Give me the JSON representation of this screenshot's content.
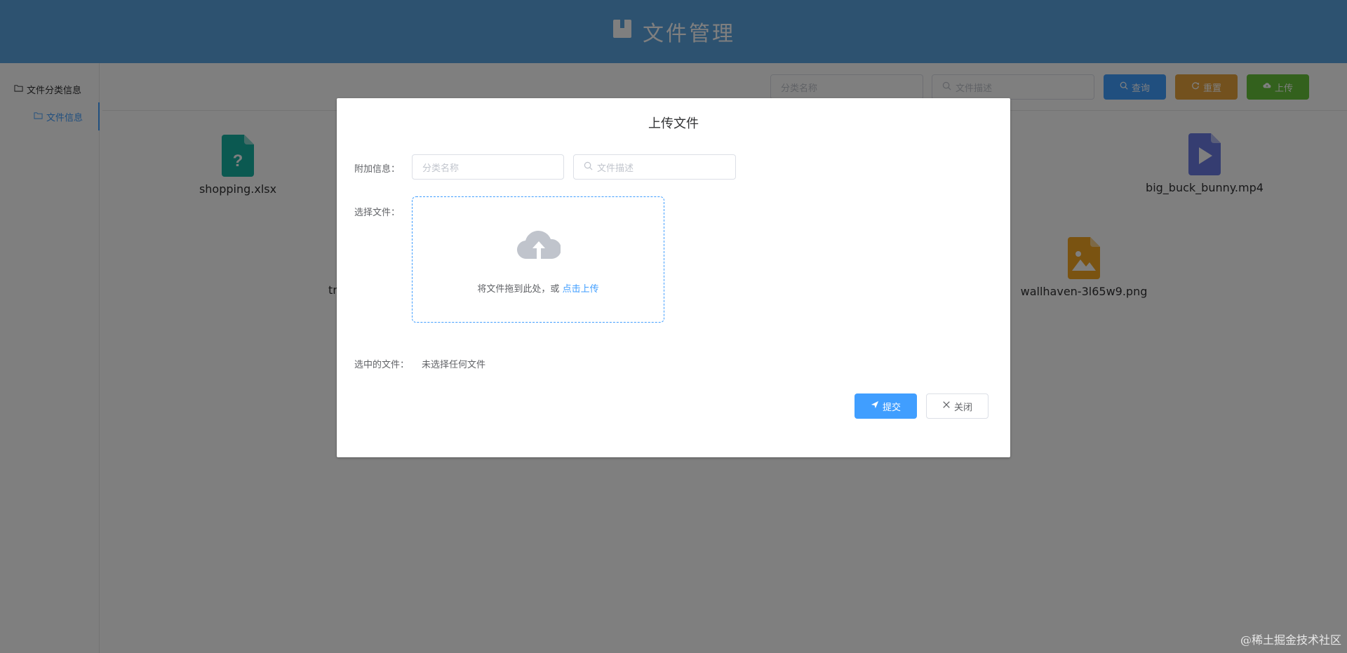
{
  "header": {
    "title": "文件管理",
    "icon": "book-icon"
  },
  "sidebar": {
    "category": {
      "label": "文件分类信息",
      "icon": "folder-icon"
    },
    "items": [
      {
        "label": "文件信息",
        "icon": "folder-icon"
      }
    ]
  },
  "toolbar": {
    "category_placeholder": "分类名称",
    "desc_placeholder": "文件描述",
    "query_label": "查询",
    "reset_label": "重置",
    "upload_label": "上传",
    "colors": {
      "query": "#409eff",
      "reset": "#e6a23c",
      "upload": "#67c23a"
    }
  },
  "files": [
    {
      "name": "shopping.xlsx",
      "icon": "unknown-file-icon",
      "color": "#17b3a3"
    },
    {
      "name": "big_buck_bunny.mp4",
      "icon": "video-file-icon",
      "color": "#6b7ae3"
    },
    {
      "name": "tr",
      "icon": "file-icon",
      "color": "#409eff"
    },
    {
      "name": "wallhaven-3l65w9.png",
      "icon": "image-file-icon",
      "color": "#f5a623"
    }
  ],
  "dialog": {
    "title": "上传文件",
    "extra_label": "附加信息：",
    "category_placeholder": "分类名称",
    "desc_placeholder": "文件描述",
    "choose_label": "选择文件：",
    "drop_text": "将文件拖到此处，或 ",
    "drop_link": "点击上传",
    "selected_label": "选中的文件：",
    "selected_value": "未选择任何文件",
    "submit_label": "提交",
    "close_label": "关闭"
  },
  "watermark": "@稀土掘金技术社区"
}
